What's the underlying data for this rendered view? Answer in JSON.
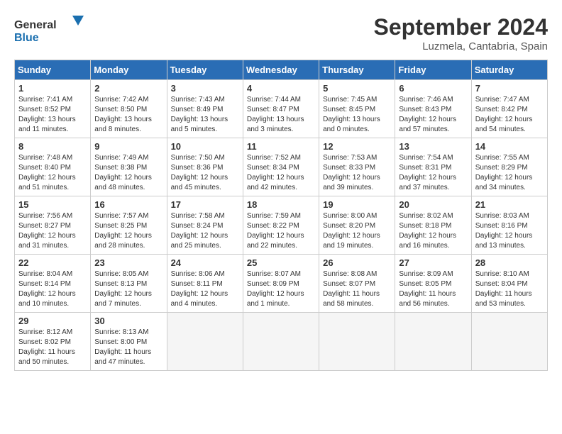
{
  "header": {
    "logo_general": "General",
    "logo_blue": "Blue",
    "title": "September 2024",
    "location": "Luzmela, Cantabria, Spain"
  },
  "days_of_week": [
    "Sunday",
    "Monday",
    "Tuesday",
    "Wednesday",
    "Thursday",
    "Friday",
    "Saturday"
  ],
  "weeks": [
    [
      {
        "day": "1",
        "sunrise": "Sunrise: 7:41 AM",
        "sunset": "Sunset: 8:52 PM",
        "daylight": "Daylight: 13 hours and 11 minutes."
      },
      {
        "day": "2",
        "sunrise": "Sunrise: 7:42 AM",
        "sunset": "Sunset: 8:50 PM",
        "daylight": "Daylight: 13 hours and 8 minutes."
      },
      {
        "day": "3",
        "sunrise": "Sunrise: 7:43 AM",
        "sunset": "Sunset: 8:49 PM",
        "daylight": "Daylight: 13 hours and 5 minutes."
      },
      {
        "day": "4",
        "sunrise": "Sunrise: 7:44 AM",
        "sunset": "Sunset: 8:47 PM",
        "daylight": "Daylight: 13 hours and 3 minutes."
      },
      {
        "day": "5",
        "sunrise": "Sunrise: 7:45 AM",
        "sunset": "Sunset: 8:45 PM",
        "daylight": "Daylight: 13 hours and 0 minutes."
      },
      {
        "day": "6",
        "sunrise": "Sunrise: 7:46 AM",
        "sunset": "Sunset: 8:43 PM",
        "daylight": "Daylight: 12 hours and 57 minutes."
      },
      {
        "day": "7",
        "sunrise": "Sunrise: 7:47 AM",
        "sunset": "Sunset: 8:42 PM",
        "daylight": "Daylight: 12 hours and 54 minutes."
      }
    ],
    [
      {
        "day": "8",
        "sunrise": "Sunrise: 7:48 AM",
        "sunset": "Sunset: 8:40 PM",
        "daylight": "Daylight: 12 hours and 51 minutes."
      },
      {
        "day": "9",
        "sunrise": "Sunrise: 7:49 AM",
        "sunset": "Sunset: 8:38 PM",
        "daylight": "Daylight: 12 hours and 48 minutes."
      },
      {
        "day": "10",
        "sunrise": "Sunrise: 7:50 AM",
        "sunset": "Sunset: 8:36 PM",
        "daylight": "Daylight: 12 hours and 45 minutes."
      },
      {
        "day": "11",
        "sunrise": "Sunrise: 7:52 AM",
        "sunset": "Sunset: 8:34 PM",
        "daylight": "Daylight: 12 hours and 42 minutes."
      },
      {
        "day": "12",
        "sunrise": "Sunrise: 7:53 AM",
        "sunset": "Sunset: 8:33 PM",
        "daylight": "Daylight: 12 hours and 39 minutes."
      },
      {
        "day": "13",
        "sunrise": "Sunrise: 7:54 AM",
        "sunset": "Sunset: 8:31 PM",
        "daylight": "Daylight: 12 hours and 37 minutes."
      },
      {
        "day": "14",
        "sunrise": "Sunrise: 7:55 AM",
        "sunset": "Sunset: 8:29 PM",
        "daylight": "Daylight: 12 hours and 34 minutes."
      }
    ],
    [
      {
        "day": "15",
        "sunrise": "Sunrise: 7:56 AM",
        "sunset": "Sunset: 8:27 PM",
        "daylight": "Daylight: 12 hours and 31 minutes."
      },
      {
        "day": "16",
        "sunrise": "Sunrise: 7:57 AM",
        "sunset": "Sunset: 8:25 PM",
        "daylight": "Daylight: 12 hours and 28 minutes."
      },
      {
        "day": "17",
        "sunrise": "Sunrise: 7:58 AM",
        "sunset": "Sunset: 8:24 PM",
        "daylight": "Daylight: 12 hours and 25 minutes."
      },
      {
        "day": "18",
        "sunrise": "Sunrise: 7:59 AM",
        "sunset": "Sunset: 8:22 PM",
        "daylight": "Daylight: 12 hours and 22 minutes."
      },
      {
        "day": "19",
        "sunrise": "Sunrise: 8:00 AM",
        "sunset": "Sunset: 8:20 PM",
        "daylight": "Daylight: 12 hours and 19 minutes."
      },
      {
        "day": "20",
        "sunrise": "Sunrise: 8:02 AM",
        "sunset": "Sunset: 8:18 PM",
        "daylight": "Daylight: 12 hours and 16 minutes."
      },
      {
        "day": "21",
        "sunrise": "Sunrise: 8:03 AM",
        "sunset": "Sunset: 8:16 PM",
        "daylight": "Daylight: 12 hours and 13 minutes."
      }
    ],
    [
      {
        "day": "22",
        "sunrise": "Sunrise: 8:04 AM",
        "sunset": "Sunset: 8:14 PM",
        "daylight": "Daylight: 12 hours and 10 minutes."
      },
      {
        "day": "23",
        "sunrise": "Sunrise: 8:05 AM",
        "sunset": "Sunset: 8:13 PM",
        "daylight": "Daylight: 12 hours and 7 minutes."
      },
      {
        "day": "24",
        "sunrise": "Sunrise: 8:06 AM",
        "sunset": "Sunset: 8:11 PM",
        "daylight": "Daylight: 12 hours and 4 minutes."
      },
      {
        "day": "25",
        "sunrise": "Sunrise: 8:07 AM",
        "sunset": "Sunset: 8:09 PM",
        "daylight": "Daylight: 12 hours and 1 minute."
      },
      {
        "day": "26",
        "sunrise": "Sunrise: 8:08 AM",
        "sunset": "Sunset: 8:07 PM",
        "daylight": "Daylight: 11 hours and 58 minutes."
      },
      {
        "day": "27",
        "sunrise": "Sunrise: 8:09 AM",
        "sunset": "Sunset: 8:05 PM",
        "daylight": "Daylight: 11 hours and 56 minutes."
      },
      {
        "day": "28",
        "sunrise": "Sunrise: 8:10 AM",
        "sunset": "Sunset: 8:04 PM",
        "daylight": "Daylight: 11 hours and 53 minutes."
      }
    ],
    [
      {
        "day": "29",
        "sunrise": "Sunrise: 8:12 AM",
        "sunset": "Sunset: 8:02 PM",
        "daylight": "Daylight: 11 hours and 50 minutes."
      },
      {
        "day": "30",
        "sunrise": "Sunrise: 8:13 AM",
        "sunset": "Sunset: 8:00 PM",
        "daylight": "Daylight: 11 hours and 47 minutes."
      },
      {
        "day": "",
        "sunrise": "",
        "sunset": "",
        "daylight": ""
      },
      {
        "day": "",
        "sunrise": "",
        "sunset": "",
        "daylight": ""
      },
      {
        "day": "",
        "sunrise": "",
        "sunset": "",
        "daylight": ""
      },
      {
        "day": "",
        "sunrise": "",
        "sunset": "",
        "daylight": ""
      },
      {
        "day": "",
        "sunrise": "",
        "sunset": "",
        "daylight": ""
      }
    ]
  ]
}
